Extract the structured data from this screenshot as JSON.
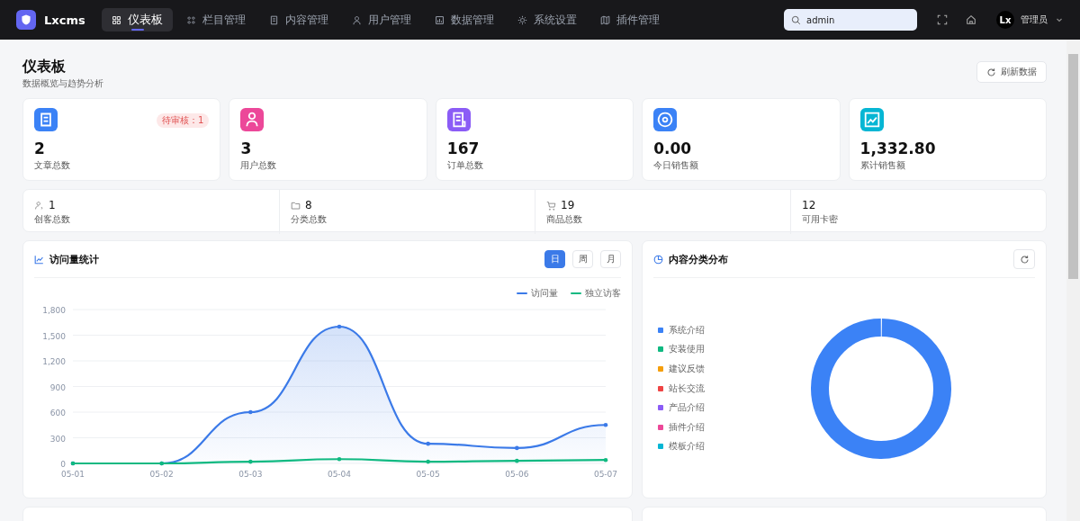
{
  "nav": {
    "logo": "Lxcms",
    "items": [
      {
        "label": "仪表板",
        "selected": true
      },
      {
        "label": "栏目管理",
        "selected": false
      },
      {
        "label": "内容管理",
        "selected": false
      },
      {
        "label": "用户管理",
        "selected": false
      },
      {
        "label": "数据管理",
        "selected": false
      },
      {
        "label": "系统设置",
        "selected": false
      },
      {
        "label": "插件管理",
        "selected": false
      }
    ],
    "search": {
      "value": "admin"
    },
    "user": {
      "avatar": "Lx",
      "name": "管理员"
    }
  },
  "page": {
    "title": "仪表板",
    "subtitle": "数据概览与趋势分析",
    "refresh": "刷新数据"
  },
  "stats": [
    {
      "value": "2",
      "label": "文章总数",
      "color": "#3b82f6",
      "badge": "待审核：1"
    },
    {
      "value": "3",
      "label": "用户总数",
      "color": "#ec4899"
    },
    {
      "value": "167",
      "label": "订单总数",
      "color": "#8b5cf6"
    },
    {
      "value": "0.00",
      "label": "今日销售额",
      "color": "#3b82f6"
    },
    {
      "value": "1,332.80",
      "label": "累计销售额",
      "color": "#06b6d4"
    }
  ],
  "counts": [
    {
      "value": "1",
      "label": "创客总数"
    },
    {
      "value": "8",
      "label": "分类总数"
    },
    {
      "value": "19",
      "label": "商品总数"
    },
    {
      "value": "12",
      "label": "可用卡密"
    }
  ],
  "visits": {
    "title": "访问量统计",
    "periods": [
      {
        "label": "日",
        "selected": true
      },
      {
        "label": "周",
        "selected": false
      },
      {
        "label": "月",
        "selected": false
      }
    ],
    "chart_data": {
      "type": "line",
      "grid": true,
      "x": [
        "05-01",
        "05-02",
        "05-03",
        "05-04",
        "05-05",
        "05-06",
        "05-07"
      ],
      "ylim": [
        0,
        1800
      ],
      "yticks": [
        0,
        300,
        600,
        900,
        {
          "value": 1200,
          "label": "1,200"
        },
        {
          "value": 1500,
          "label": "1,500"
        },
        {
          "value": 1800,
          "label": "1,800"
        }
      ],
      "series": [
        {
          "name": "访问量",
          "type": "area",
          "color": "#3b7ae8",
          "values": [
            0,
            0,
            600,
            1600,
            230,
            180,
            450
          ]
        },
        {
          "name": "独立访客",
          "type": "line",
          "color": "#10b981",
          "values": [
            0,
            0,
            20,
            50,
            20,
            30,
            40
          ]
        }
      ]
    }
  },
  "categories": {
    "title": "内容分类分布",
    "legend": [
      {
        "label": "系统介绍",
        "color": "#3b82f6"
      },
      {
        "label": "安装使用",
        "color": "#10b981"
      },
      {
        "label": "建议反馈",
        "color": "#f59e0b"
      },
      {
        "label": "站长交流",
        "color": "#ef4444"
      },
      {
        "label": "产品介绍",
        "color": "#8b5cf6"
      },
      {
        "label": "插件介绍",
        "color": "#ec4899"
      },
      {
        "label": "模板介绍",
        "color": "#06b6d4"
      }
    ]
  }
}
